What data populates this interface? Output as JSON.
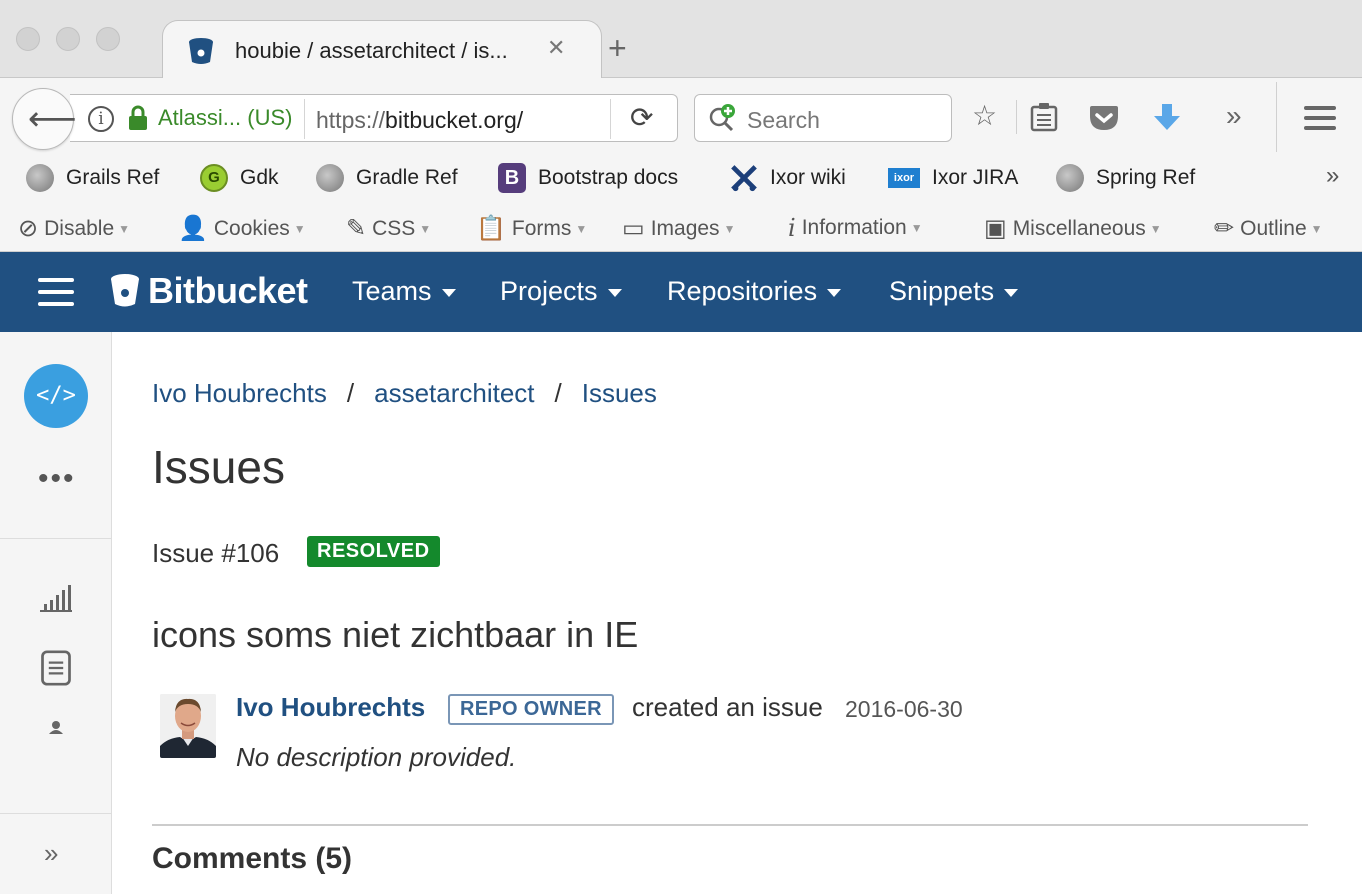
{
  "browser": {
    "tab_title": "houbie / assetarchitect / is...",
    "tab_close": "✕",
    "new_tab": "+",
    "site_identity": "Atlassi... (US)",
    "url_scheme": "https://",
    "url_host": "bitbucket.org/",
    "search_placeholder": "Search",
    "bookmarks": [
      "Grails Ref",
      "Gdk",
      "Gradle Ref",
      "Bootstrap docs",
      "Ixor wiki",
      "Ixor JIRA",
      "Spring Ref"
    ],
    "devtools": [
      "Disable",
      "Cookies",
      "CSS",
      "Forms",
      "Images",
      "Information",
      "Miscellaneous",
      "Outline"
    ]
  },
  "header": {
    "logo": "Bitbucket",
    "nav": [
      "Teams",
      "Projects",
      "Repositories",
      "Snippets"
    ]
  },
  "breadcrumb": [
    "Ivo Houbrechts",
    "assetarchitect",
    "Issues"
  ],
  "page_title": "Issues",
  "issue": {
    "number": "Issue #106",
    "status": "RESOLVED",
    "title": "icons soms niet zichtbaar in IE",
    "author": "Ivo Houbrechts",
    "author_badge": "REPO OWNER",
    "action": "created an issue",
    "date": "2016-06-30",
    "description": "No description provided."
  },
  "comments_heading": "Comments (5)",
  "colors": {
    "header_bg": "#205081",
    "link": "#205081",
    "resolved": "#14892c",
    "code_button": "#3a9fe0"
  }
}
